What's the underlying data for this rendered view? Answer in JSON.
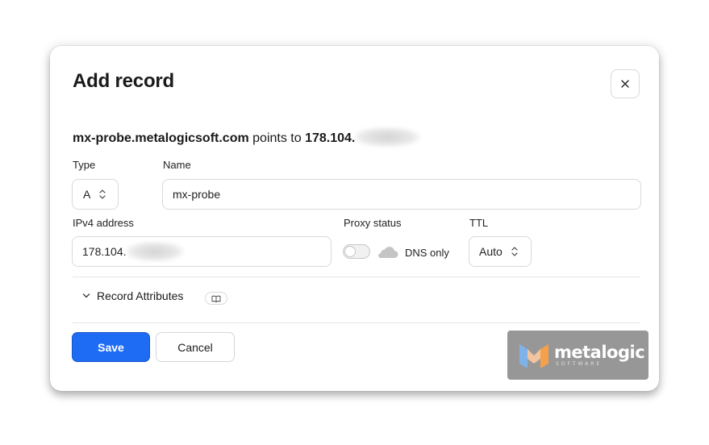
{
  "dialog": {
    "title": "Add record",
    "close_icon": "close-icon"
  },
  "summary": {
    "hostname": "mx-probe.metalogicsoft.com",
    "points_to_text": " points to ",
    "ip_prefix": "178.104."
  },
  "type_field": {
    "label": "Type",
    "value": "A"
  },
  "name_field": {
    "label": "Name",
    "value": "mx-probe"
  },
  "ipv4_field": {
    "label": "IPv4 address",
    "value": "178.104."
  },
  "proxy": {
    "label": "Proxy status",
    "toggle_on": false,
    "status_text": "DNS only",
    "icon": "cloud-icon"
  },
  "ttl_field": {
    "label": "TTL",
    "value": "Auto"
  },
  "record_attributes": {
    "label": "Record Attributes",
    "icon": "book-icon"
  },
  "actions": {
    "save_label": "Save",
    "cancel_label": "Cancel"
  },
  "watermark": {
    "brand": "metalogic",
    "tagline": "SOFTWARE"
  },
  "colors": {
    "primary": "#1f6cf4",
    "border": "#d9d9d9",
    "text": "#1a1a1a"
  }
}
